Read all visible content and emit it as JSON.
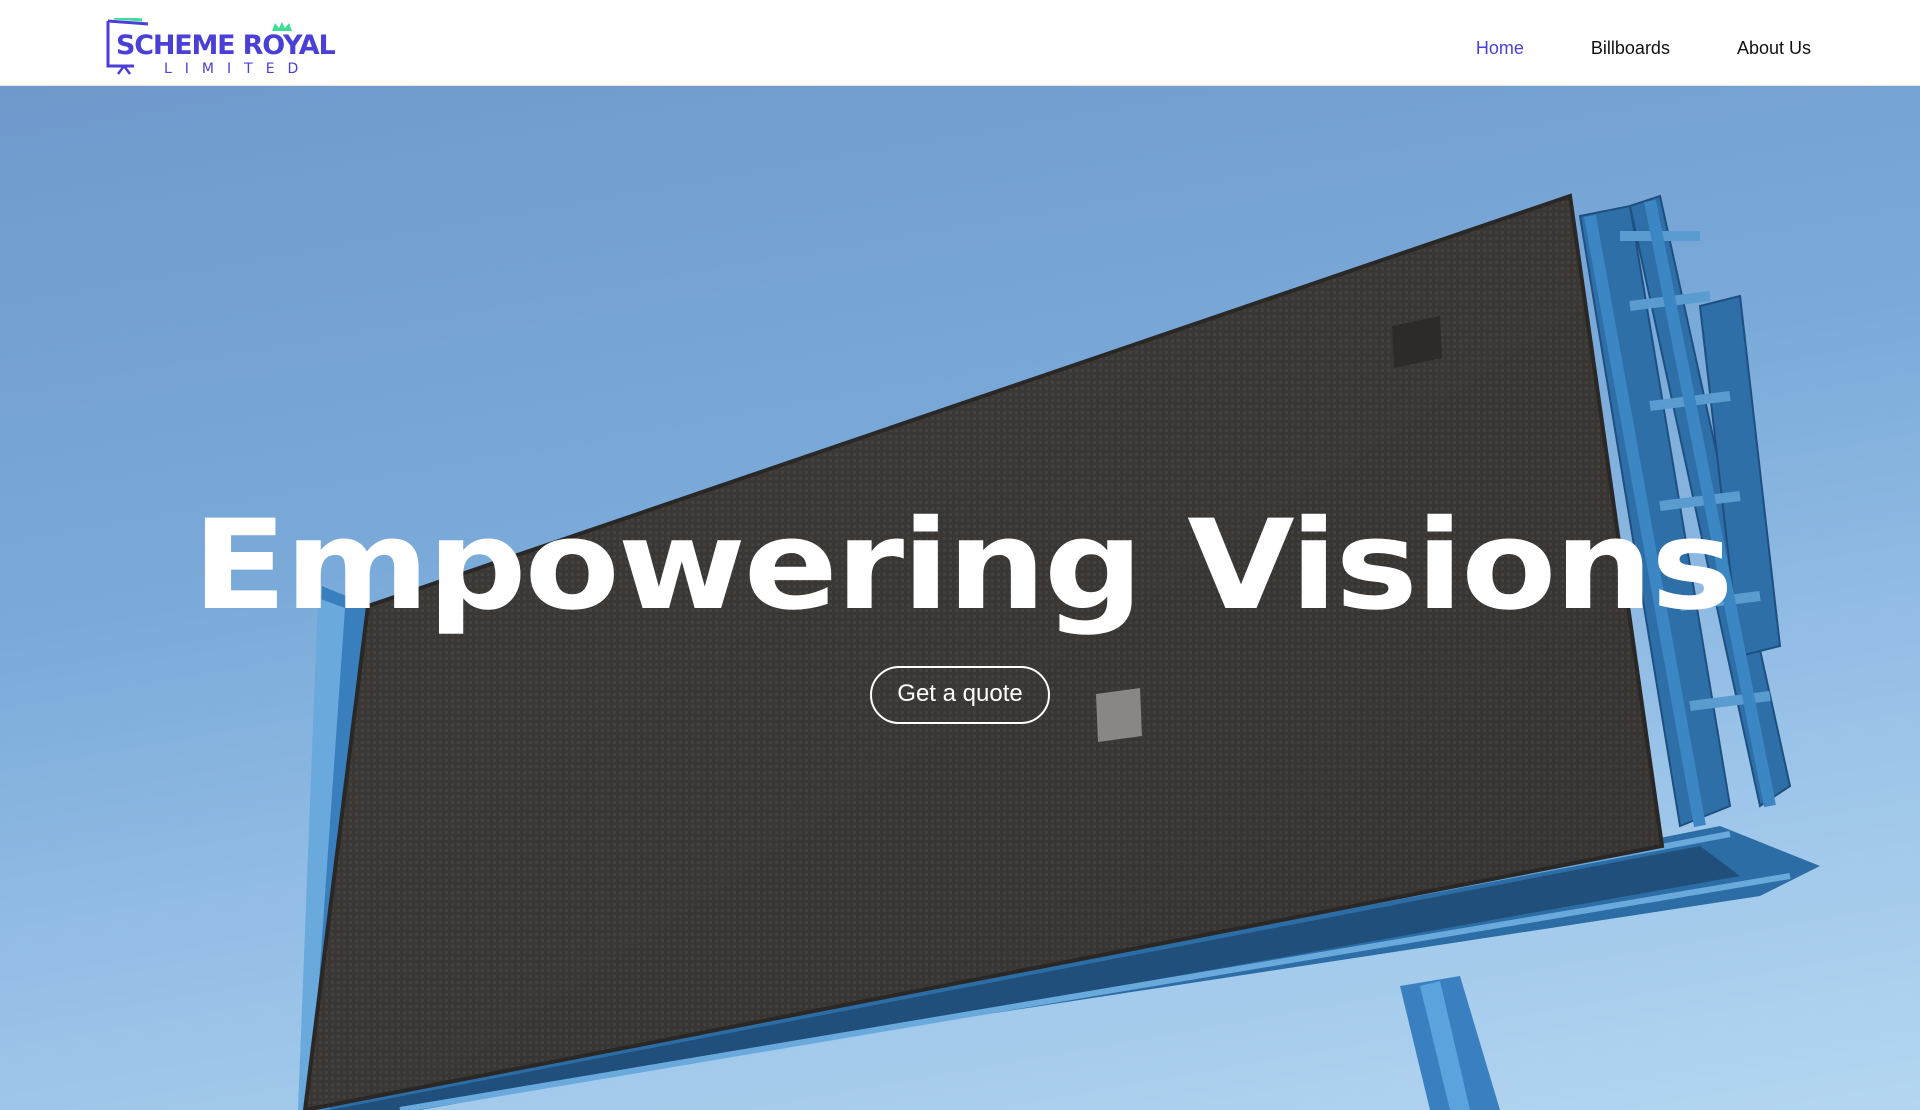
{
  "brand": {
    "name": "SCHEME ROYAL",
    "tagline": "LIMITED",
    "logo_icon": "billboard-crown-logo",
    "primary_color": "#4a3fd6",
    "accent_color": "#3ddc97"
  },
  "nav": {
    "items": [
      {
        "label": "Home",
        "active": true
      },
      {
        "label": "Billboards",
        "active": false
      },
      {
        "label": "About Us",
        "active": false
      }
    ]
  },
  "hero": {
    "title": "Empowering Visions",
    "cta_label": "Get a quote",
    "background_image": "digital-billboard-against-blue-sky"
  }
}
